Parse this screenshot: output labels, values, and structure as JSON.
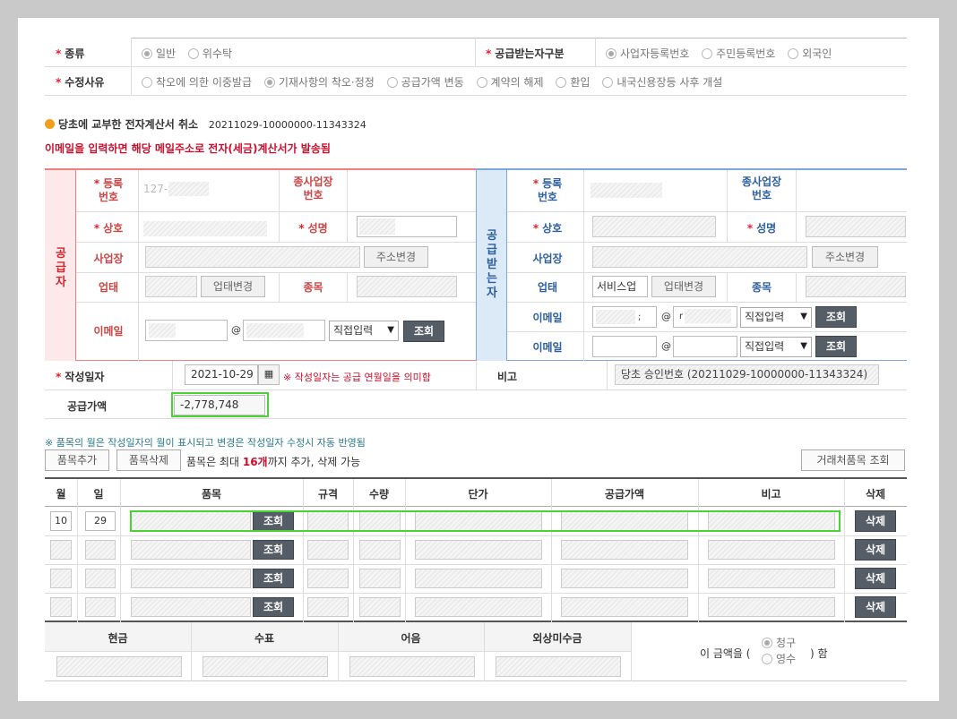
{
  "type_row": {
    "label": "종류",
    "options": [
      "일반",
      "위수탁"
    ],
    "recipient_label": "공급받는자구분",
    "recipient_options": [
      "사업자등록번호",
      "주민등록번호",
      "외국인"
    ]
  },
  "reason_row": {
    "label": "수정사유",
    "options": [
      "착오에 의한 이중발급",
      "기재사항의 착오·정정",
      "공급가액 변동",
      "계약의 해제",
      "환입",
      "내국신용장등 사후 개설"
    ]
  },
  "cancel_section": {
    "title": "당초에 교부한 전자계산서 취소",
    "number": "20211029-10000000-11343324",
    "email_notice": "이메일을 입력하면 해당 메일주소로 전자(세금)계산서가 발송됨"
  },
  "supplier": {
    "side_label": "공급자",
    "reg_no_label": "등록\n번호",
    "reg_no_value": "127-",
    "sub_biz_label": "종사업장\n번호",
    "company_label": "상호",
    "name_label": "성명",
    "address_label": "사업장",
    "address_btn": "주소변경",
    "biz_type_label": "업태",
    "biz_type_btn": "업태변경",
    "item_label": "종목",
    "email_label": "이메일",
    "at": "@",
    "email_select": "직접입력",
    "lookup_btn": "조회"
  },
  "receiver": {
    "side_label": "공급받는자",
    "reg_no_label": "등록\n번호",
    "sub_biz_label": "종사업장\n번호",
    "company_label": "상호",
    "name_label": "성명",
    "address_label": "사업장",
    "address_btn": "주소변경",
    "biz_type_label": "업태",
    "biz_type_value": "서비스업",
    "biz_type_btn": "업태변경",
    "item_label": "종목",
    "email_label": "이메일",
    "email1_local": ";",
    "email1_domain": "r",
    "at": "@",
    "email_select": "직접입력",
    "lookup_btn": "조회"
  },
  "date_row": {
    "label": "작성일자",
    "value": "2021-10-29",
    "note": "※ 작성일자는 공급 연월일을 의미함",
    "remark_label": "비고",
    "remark_value": "당초 승인번호 (20211029-10000000-11343324)"
  },
  "supply_row": {
    "label": "공급가액",
    "value": "-2,778,748"
  },
  "items_section": {
    "notice": "※ 품목의 월은 작성일자의 월이 표시되고 변경은 작성일자 수정시 자동 반영됨",
    "add_btn": "품목추가",
    "delete_btn": "품목삭제",
    "limit_prefix": "품목은 최대 ",
    "limit_count": "16개",
    "limit_suffix": "까지 추가, 삭제 가능",
    "partner_btn": "거래처품목 조회",
    "headers": [
      "월",
      "일",
      "품목",
      "규격",
      "수량",
      "단가",
      "공급가액",
      "비고",
      "삭제"
    ],
    "rows": [
      {
        "month": "10",
        "day": "29"
      },
      {
        "month": "",
        "day": ""
      },
      {
        "month": "",
        "day": ""
      },
      {
        "month": "",
        "day": ""
      }
    ],
    "lookup_btn": "조회",
    "delete_row_btn": "삭제"
  },
  "payment": {
    "headers": [
      "현금",
      "수표",
      "어음",
      "외상미수금"
    ],
    "amount_text_prefix": "이 금액을 (",
    "amount_text_suffix": ") 함",
    "options": [
      "청구",
      "영수"
    ]
  },
  "colors": {
    "required": "#d9242f",
    "supplier_border": "#f07e7e",
    "supplier_bg": "#fde9e9",
    "receiver_border": "#7da7d9",
    "receiver_bg": "#dce9f7",
    "highlight": "#4cd137",
    "dark_button": "#555d66"
  }
}
